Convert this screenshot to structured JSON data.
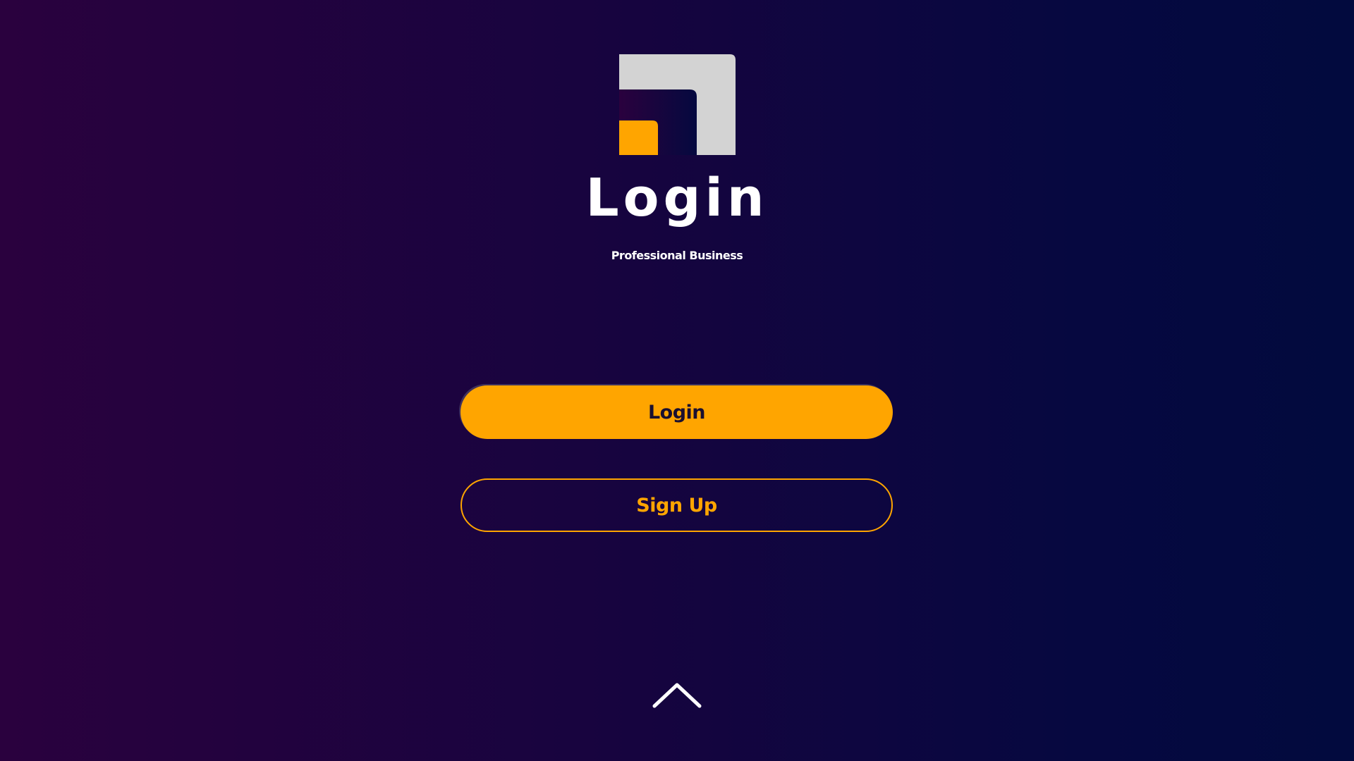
{
  "header": {
    "title": "Login",
    "subtitle": "Professional Business"
  },
  "logo": {
    "icon": "brand-logo-icon",
    "colors": {
      "outer": "#d3d3d3",
      "accent": "#ffa500"
    }
  },
  "actions": {
    "login_label": "Login",
    "signup_label": "Sign Up"
  },
  "footer": {
    "icon": "chevron-up-icon"
  },
  "colors": {
    "accent": "#ffa500",
    "background_left": "#2a013e",
    "background_right": "#020a3e",
    "text": "#ffffff"
  }
}
